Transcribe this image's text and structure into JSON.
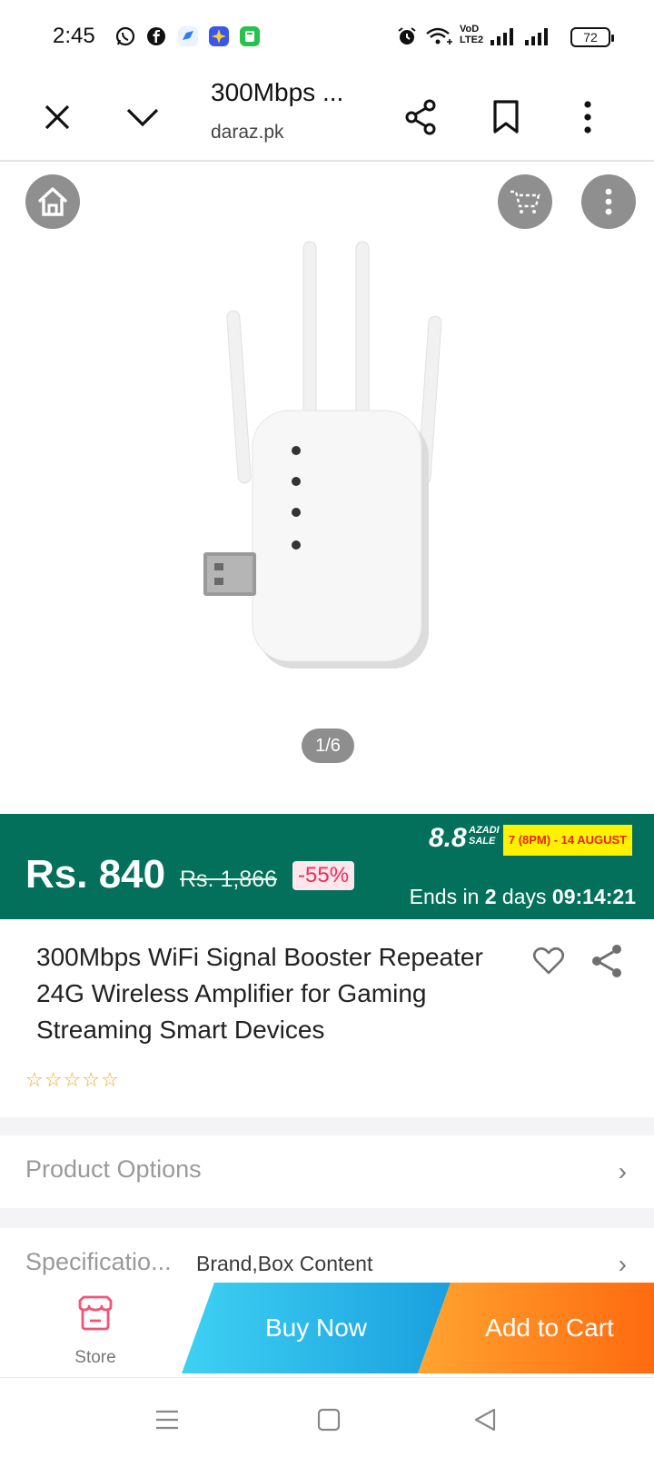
{
  "status_bar": {
    "time": "2:45",
    "network_label": "VoD LTE2",
    "battery": "72",
    "left_icons": [
      "whatsapp-icon",
      "facebook-icon",
      "messenger-icon",
      "app-icon",
      "calculator-icon"
    ],
    "right_icons": [
      "alarm-icon",
      "wifi-icon",
      "signal-icon",
      "signal-icon"
    ]
  },
  "browser": {
    "page_title": "300Mbps ...",
    "url": "daraz.pk",
    "icons": [
      "close-icon",
      "chevron-down-icon",
      "share-icon",
      "bookmark-icon",
      "more-vert-icon"
    ]
  },
  "gallery": {
    "counter": "1/6",
    "overlay_icons": [
      "home-icon",
      "cart-icon",
      "more-vert-icon"
    ]
  },
  "price_bar": {
    "price": "Rs. 840",
    "original_price": "Rs. 1,866",
    "discount": "-55%",
    "sale_logo": "8.8",
    "sale_logo_sub": "AZADI SALE",
    "sale_dates": "7 (8PM) - 14 AUGUST",
    "ends_prefix": "Ends in ",
    "ends_days": "2",
    "ends_days_label": " days ",
    "ends_time": "09:14:21",
    "colors": {
      "background": "#02705a",
      "discount_text": "#ec2e5a",
      "sale_badge": "#fff200"
    }
  },
  "product": {
    "title": "300Mbps WiFi Signal Booster Repeater 24G Wireless Amplifier for Gaming Streaming Smart Devices",
    "rating_stars": 0,
    "stars": [
      "☆",
      "☆",
      "☆",
      "☆",
      "☆"
    ],
    "icons": [
      "heart-icon",
      "share-icon"
    ]
  },
  "rows": {
    "options_label": "Product Options",
    "specs_label": "Specificatio...",
    "specs_value": "Brand,Box Content",
    "chevron": "›"
  },
  "actions": {
    "store_label": "Store",
    "buy_now": "Buy Now",
    "add_to_cart": "Add to Cart"
  },
  "system_nav": {
    "icons": [
      "menu-icon",
      "home-square-icon",
      "back-icon"
    ]
  }
}
